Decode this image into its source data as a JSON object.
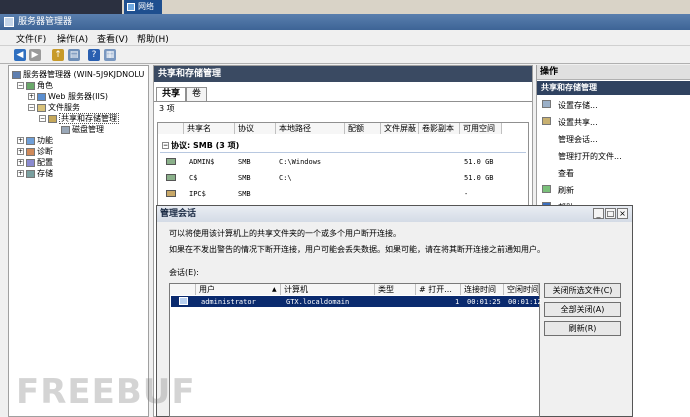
{
  "taskbar": {
    "network_label": "网络"
  },
  "window": {
    "title": "服务器管理器"
  },
  "menu": [
    "文件(F)",
    "操作(A)",
    "查看(V)",
    "帮助(H)"
  ],
  "tree": {
    "root": "服务器管理器 (WIN-5J9KJDNOLU",
    "roles": "角色",
    "web": "Web 服务器(IIS)",
    "file_services": "文件服务",
    "share_storage": "共享和存储管理",
    "disk": "磁盘管理",
    "features": "功能",
    "diagnostics": "诊断",
    "configuration": "配置",
    "storage": "存储"
  },
  "middle": {
    "title": "共享和存储管理",
    "tabs": [
      "共享",
      "卷"
    ],
    "count": "3 项",
    "columns": [
      "共享名",
      "协议",
      "本地路径",
      "配额",
      "文件屏蔽",
      "卷影副本",
      "可用空间"
    ],
    "group": "协议: SMB (3 项)",
    "rows": [
      {
        "name": "ADMIN$",
        "protocol": "SMB",
        "path": "C:\\Windows",
        "free": "51.0 GB"
      },
      {
        "name": "C$",
        "protocol": "SMB",
        "path": "C:\\",
        "free": "51.0 GB"
      },
      {
        "name": "IPC$",
        "protocol": "SMB",
        "path": "",
        "free": "-"
      }
    ]
  },
  "actions": {
    "header": "操作",
    "section": "共享和存储管理",
    "items": [
      "设置存储...",
      "设置共享...",
      "管理会话...",
      "管理打开的文件...",
      "查看",
      "刷新",
      "帮助"
    ]
  },
  "dialog": {
    "title": "管理会话",
    "line1": "可以将使用该计算机上的共享文件夹的一个或多个用户断开连接。",
    "line2": "如果在不发出警告的情况下断开连接，用户可能会丢失数据。如果可能，请在将其断开连接之前通知用户。",
    "sessions_label": "会话(E):",
    "columns": [
      "用户",
      "计算机",
      "类型",
      "# 打开...",
      "连接时间",
      "空闲时间"
    ],
    "session": {
      "user": "administrator",
      "computer": "GTX.localdomain",
      "type": "",
      "open": "1",
      "connected": "00:01:25",
      "idle": "00:01:12"
    },
    "buttons": {
      "close_files": "关闭所选文件(C)",
      "close_all": "全部关闭(A)",
      "refresh": "刷新(R)"
    }
  },
  "watermark": "FREEBUF",
  "colors": {
    "panel_header": "#3a4a62",
    "selection": "#0a2a6e",
    "titlebar": "#3d6496"
  }
}
